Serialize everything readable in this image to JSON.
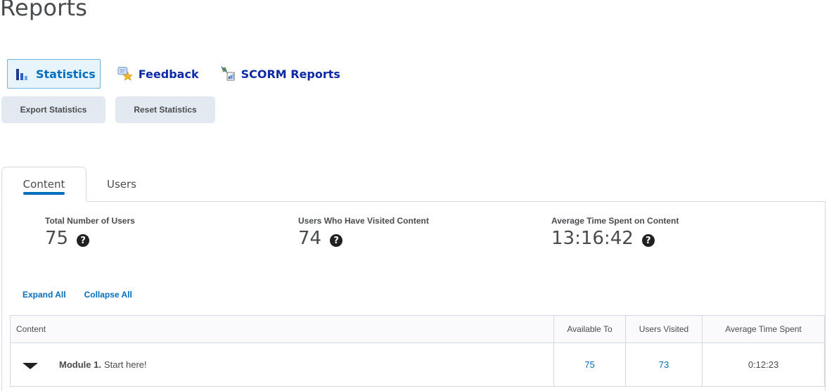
{
  "page": {
    "title": "Reports"
  },
  "nav": {
    "items": [
      {
        "label": "Statistics",
        "icon": "bar-chart-icon",
        "active": true
      },
      {
        "label": "Feedback",
        "icon": "feedback-star-icon",
        "active": false
      },
      {
        "label": "SCORM Reports",
        "icon": "scorm-report-icon",
        "active": false
      }
    ]
  },
  "actions": {
    "export_label": "Export Statistics",
    "reset_label": "Reset Statistics"
  },
  "tabs": {
    "content": "Content",
    "users": "Users"
  },
  "stats": {
    "total_users": {
      "label": "Total Number of Users",
      "value": "75"
    },
    "visited_users": {
      "label": "Users Who Have Visited Content",
      "value": "74"
    },
    "avg_time": {
      "label": "Average Time Spent on Content",
      "value": "13:16:42"
    },
    "help_glyph": "?"
  },
  "links": {
    "expand": "Expand All",
    "collapse": "Collapse All"
  },
  "table": {
    "headers": {
      "content": "Content",
      "available": "Available To",
      "visited": "Users Visited",
      "avg": "Average Time Spent"
    },
    "rows": [
      {
        "module": "Module 1.",
        "title": "Start here!",
        "available": "75",
        "visited": "73",
        "avg": "0:12:23"
      }
    ]
  },
  "colors": {
    "accent": "#006fbf",
    "button_bg": "#e3e9f1",
    "border": "#d3d9e3"
  }
}
